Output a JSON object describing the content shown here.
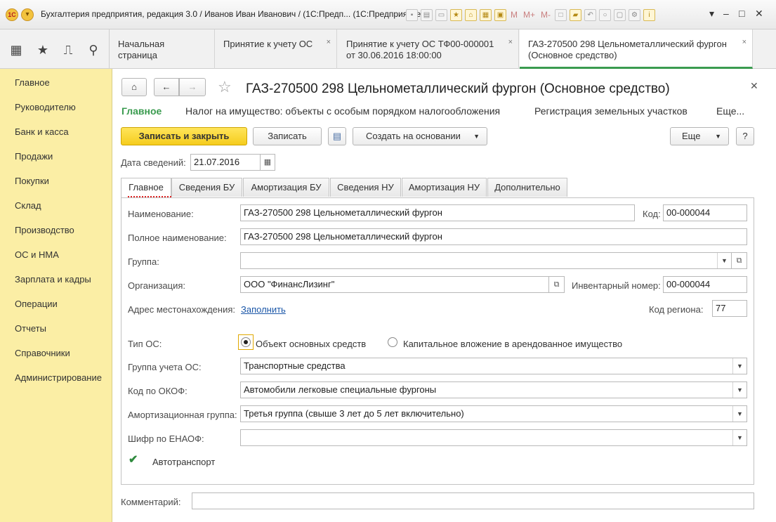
{
  "window": {
    "title": "Бухгалтерия предприятия, редакция 3.0 / Иванов Иван Иванович / (1С:Предп...  (1С:Предприятие)",
    "toolbar_text_m": "M",
    "toolbar_text_mplus": "M+",
    "toolbar_text_mminus": "M-"
  },
  "tabs": [
    {
      "label": "Начальная страница"
    },
    {
      "label": "Принятие к учету ОС"
    },
    {
      "label": "Принятие к учету ОС ТФ00-000001 от 30.06.2016 18:00:00"
    },
    {
      "label": "ГАЗ-270500 298 Цельнометаллический фургон (Основное средство)"
    }
  ],
  "sidebar": {
    "items": [
      {
        "label": "Главное"
      },
      {
        "label": "Руководителю"
      },
      {
        "label": "Банк и касса"
      },
      {
        "label": "Продажи"
      },
      {
        "label": "Покупки"
      },
      {
        "label": "Склад"
      },
      {
        "label": "Производство"
      },
      {
        "label": "ОС и НМА"
      },
      {
        "label": "Зарплата и кадры"
      },
      {
        "label": "Операции"
      },
      {
        "label": "Отчеты"
      },
      {
        "label": "Справочники"
      },
      {
        "label": "Администрирование"
      }
    ]
  },
  "form": {
    "title": "ГАЗ-270500 298 Цельнометаллический фургон (Основное средство)",
    "subnav": {
      "main": "Главное",
      "tax": "Налог на имущество: объекты с особым порядком налогообложения",
      "land": "Регистрация земельных участков",
      "more": "Еще..."
    },
    "buttons": {
      "save_close": "Записать и закрыть",
      "save": "Записать",
      "create_based": "Создать на основании",
      "more": "Еще",
      "help": "?"
    },
    "date_label": "Дата сведений:",
    "date_value": "21.07.2016",
    "tabs": [
      {
        "label": "Главное"
      },
      {
        "label": "Сведения БУ"
      },
      {
        "label": "Амортизация БУ"
      },
      {
        "label": "Сведения НУ"
      },
      {
        "label": "Амортизация НУ"
      },
      {
        "label": "Дополнительно"
      }
    ],
    "fields": {
      "name_label": "Наименование:",
      "name_value": "ГАЗ-270500 298 Цельнометаллический фургон",
      "code_label": "Код:",
      "code_value": "00-000044",
      "fullname_label": "Полное наименование:",
      "fullname_value": "ГАЗ-270500 298 Цельнометаллический фургон",
      "group_label": "Группа:",
      "group_value": "",
      "org_label": "Организация:",
      "org_value": "ООО \"ФинансЛизинг\"",
      "inv_label": "Инвентарный номер:",
      "inv_value": "00-000044",
      "address_label": "Адрес местонахождения:",
      "address_link": "Заполнить",
      "region_label": "Код региона:",
      "region_value": "77",
      "type_label": "Тип ОС:",
      "type_option1": "Объект основных средств",
      "type_option2": "Капитальное вложение в арендованное имущество",
      "acc_group_label": "Группа учета ОС:",
      "acc_group_value": "Транспортные средства",
      "okof_label": "Код по ОКОФ:",
      "okof_value": "Автомобили легковые специальные фургоны",
      "amort_group_label": "Амортизационная группа:",
      "amort_group_value": "Третья группа (свыше 3 лет до 5 лет включительно)",
      "enaof_label": "Шифр по ЕНАОФ:",
      "enaof_value": "",
      "auto_label": "Автотранспорт",
      "comment_label": "Комментарий:",
      "comment_value": ""
    }
  }
}
